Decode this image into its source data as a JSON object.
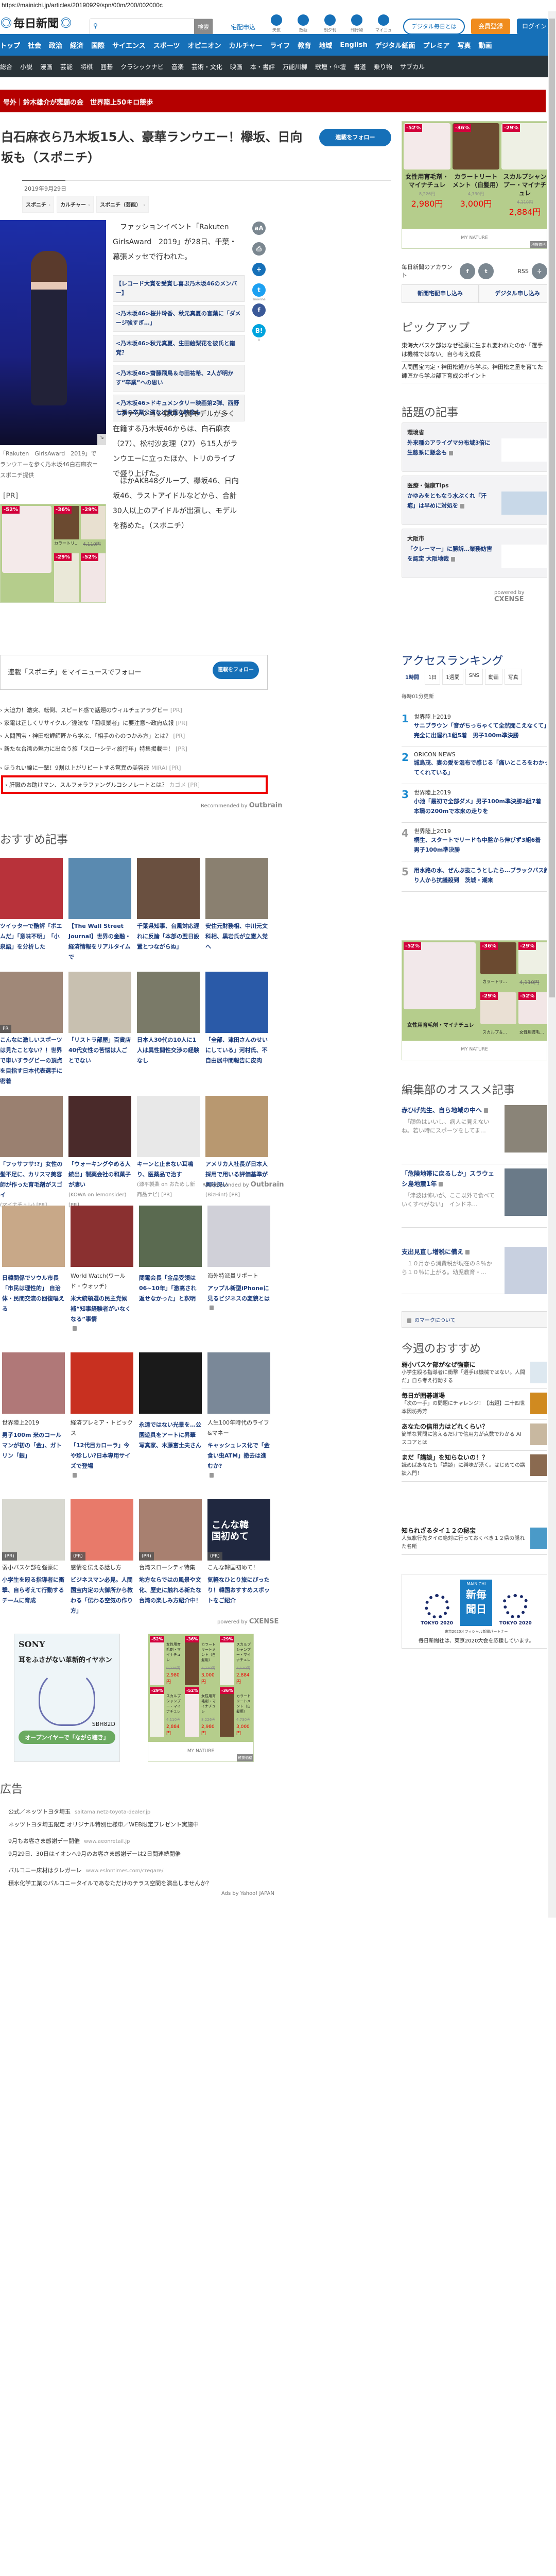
{
  "url": "https://mainichi.jp/articles/20190929/spn/00m/200/002000c",
  "header": {
    "logo": "毎日新聞",
    "search_placeholder": "",
    "search_button": "検索",
    "takuhai": "宅配申込",
    "icons": [
      {
        "label": "天気",
        "icon": "weather-icon"
      },
      {
        "label": "数独",
        "icon": "sudoku-icon"
      },
      {
        "label": "朝夕刊",
        "icon": "newspaper-icon"
      },
      {
        "label": "刊行物",
        "icon": "book-icon"
      },
      {
        "label": "マイニュース",
        "icon": "mynews-icon"
      }
    ],
    "digital": "デジタル毎日とは",
    "register": "会員登録",
    "login": "ログイン"
  },
  "nav": [
    "トップ",
    "社会",
    "政治",
    "経済",
    "国際",
    "サイエンス",
    "スポーツ",
    "オピニオン",
    "カルチャー",
    "ライフ",
    "教育",
    "地域",
    "English",
    "デジタル紙面",
    "プレミア",
    "写真",
    "動画"
  ],
  "subnav": [
    "総合",
    "小説",
    "漫画",
    "芸能",
    "将棋",
    "囲碁",
    "クラシックナビ",
    "音楽",
    "芸術・文化",
    "映画",
    "本・書評",
    "万能川柳",
    "歌壇・俳壇",
    "書道",
    "乗り物",
    "サブカル"
  ],
  "extra": "号外｜鈴木雄介が悲願の金　世界陸上50キロ競歩",
  "article": {
    "title": "白石麻衣ら乃木坂15人、豪華ランウエー！欅坂、日向坂も（スポニチ）",
    "follow": "連載をフォロー",
    "date": "2019年9月29日",
    "tags": [
      "スポニチ",
      "カルチャー",
      "スポニチ（芸能）"
    ],
    "caption": "「Rakuten　GirlsAward　2019」でランウエーを歩く乃木坂46白石麻衣＝スポニチ提供",
    "p1": "　ファッションイベント「Rakuten GirlsAward　2019」が28日、千葉・幕張メッセで行われた。",
    "related": [
      "【レコード大賞を受賞し喜ぶ乃木坂46のメンバー】",
      "<乃木坂46>桜井玲香、秋元真夏の言葉に「ダメージ強すぎ…」",
      "<乃木坂46>秋元真夏、生田絵梨花を彼氏と錯覚？",
      "<乃木坂46>齋藤飛鳥＆与田祐希、2人が明かす“卒業”への思い",
      "<乃木坂46>ドキュメンタリー映画第2弾、西野七瀬の卒業公演など貴重な映像も"
    ],
    "p2": "　ファッション誌の専属モデルが多く在籍する乃木坂46からは、白石麻衣（27）、松村沙友理（27）ら15人がランウエーに立ったほか、トリのライブで盛り上げた。",
    "p3": "　ほかAKB48グループ、欅坂46、日向坂46、ラストアイドルなどから、合計30人以上のアイドルが出演し、モデルを務めた。（スポニチ）",
    "share_twitter_label": "Timeline",
    "share_hatena_count": "0"
  },
  "pr_label": "[PR]",
  "ad_products": [
    {
      "disc": "-52%",
      "name": "女性用育毛剤・マイナチュレ",
      "old": "8,226円",
      "price": "2,980円"
    },
    {
      "disc": "-36%",
      "name": "カラートリートメント（白髪用）",
      "old": "4,730円",
      "price": "3,000円"
    },
    {
      "disc": "-29%",
      "name": "スカルプシャンプー・マイナチュレ",
      "old": "4,110円",
      "price": "2,884円"
    }
  ],
  "ad_brand": "MY NATURE",
  "ad_tax": "税抜価格",
  "ad_small": {
    "label1": "カラートリ...",
    "price": "4,110円",
    "label2": "スカルプ＆...",
    "label3": "女性用育毛...",
    "main": "女性用育毛剤・マイナチュレ",
    "d4": "-29%",
    "d5": "-52%"
  },
  "followbox": {
    "text": "連載「スポニチ」をマイニュースでフォロー",
    "button": "連載をフォロー"
  },
  "pr_links": [
    {
      "t": "大迫力！激突、転倒、スピード感で話題のウィルチェアラグビー",
      "s": "",
      "p": "[PR]"
    },
    {
      "t": "家電は正しくリサイクル／違法な「回収業者」に要注意～政府広報",
      "s": "",
      "p": "[PR]"
    },
    {
      "t": "人間国宝・神田松鯉師匠から学ぶ、「相手の心のつかみ方」とは？",
      "s": "",
      "p": "[PR]"
    },
    {
      "t": "新たな台湾の魅力に出会う旅「スローシティ旅行年」特集掲載中！",
      "s": "",
      "p": "[PR]"
    },
    {
      "t": "ほうれい線に一撃！9割以上がリピートする驚異の美容液",
      "s": "MIRAI",
      "p": "[PR]"
    }
  ],
  "pr_highlight": {
    "t": "肝臓のお助けマン、スルフォラファングルコシノレートとは？",
    "s": "カゴメ",
    "p": "[PR]"
  },
  "recommended_by": "Recommended by",
  "outbrain": "Outbrain",
  "osusume_title": "おすすめ記事",
  "grid1": [
    {
      "t": "ツイッターで酷評「ポエムだ」「意味不明」　「小泉語」を分析した",
      "c": "#b8323a"
    },
    {
      "t": "【The Wall Street Journal】世界の金融・経済情報をリアルタイムで",
      "c": "#5a8ab0"
    },
    {
      "t": "千葉県知事、台風対応遅れに反論「本部の翌日設置とつながらぬ」",
      "c": "#6a5040"
    },
    {
      "t": "安住元財務相、中川元文科相、黒岩氏が立憲入党へ",
      "c": "#8a8070"
    },
    {
      "t": "こんなに激しいスポーツは見たことない？！世界で車いすラグビーの頂点を目指す日本代表選手に密着",
      "c": "#a08878",
      "pr": "PR"
    },
    {
      "t": "「リストラ部屋」百貨店40代女性の苦悩は人ごとでない",
      "c": "#c8c0b0"
    },
    {
      "t": "日本人30代の10人に1人は異性間性交渉の経験なし",
      "c": "#7a7a68"
    },
    {
      "t": "「全部、津田さんのせいにしている」河村氏、不自由展中間報告に皮肉",
      "c": "#2a5aa8"
    },
    {
      "t": "「フッサフサ!?」女性の髪不足に、カリスマ美容師が作った育毛剤がスゴイ",
      "s": "(マイナチュレ) [PR]",
      "c": "#9a8070"
    },
    {
      "t": "「ウォーキングやめる人続出」製薬会社の和菓子が凄い",
      "s": "(KOWA on lemonsider) [PR]",
      "c": "#4a2a2a"
    },
    {
      "t": "キーンと止まない耳鳴り、医薬品で治す",
      "s": "(源平製薬 on おためし新商品ナビ) [PR]",
      "c": "#e8e8e8"
    },
    {
      "t": "アメリカ人社長が日本人採用で用いる評価基準が興味深い",
      "s": "(BizHint) [PR]",
      "c": "#b89870"
    }
  ],
  "grid2": [
    {
      "t": "日韓関係でソウル市長「市民は理性的」 自治体・民間交流の回復唱える",
      "c": "#c8a888"
    },
    {
      "cat": "World Watch(ワールド・ウォッチ)",
      "t": "米大統領選の民主党候補“知事経験者がいなくなる”事情",
      "lock": true,
      "c": "#8a3030"
    },
    {
      "t": "関電会長「金品受領は06~10年」「激高され返せなかった」と釈明",
      "c": "#5a6a50"
    },
    {
      "cat": "海外特派員リポート",
      "t": "アップル新型iPhoneに見るビジネスの変貌とは",
      "lock": true,
      "c": "#d0d0d8"
    },
    {
      "cat": "世界陸上2019",
      "t": "男子100m 米のコールマンが初の「金」、ガトリン「銀」",
      "c": "#b07878"
    },
    {
      "cat": "経済プレミア・トピックス",
      "t": "「12代目カローラ」今や珍しい?日本専用サイズで登場",
      "lock": true,
      "c": "#c83020"
    },
    {
      "t": "永遠ではない光景を…公園遊具をアートに昇華 写真家、木藤富士夫さん",
      "c": "#1a1a1a"
    },
    {
      "cat": "人生100年時代のライフ&マネー",
      "t": "キャッシュレス化で「金食い虫ATM」撤去は進むか?",
      "lock": true,
      "c": "#7a8898"
    },
    {
      "t": "弱小バスケ部を強豪に",
      "s": "小学生を殴る指導者に衝撃、自ら考えて行動するチームに育成",
      "pr": "(PR)",
      "c": "#d8d8d0"
    },
    {
      "t": "感情を伝える話し方",
      "s": "ビジネスマン必見。人間国宝内定の大御所から教わる「伝わる空気の作り方」",
      "pr": "(PR)",
      "c": "#e87a6a"
    },
    {
      "t": "台湾スローシティ特集",
      "s": "地方ならではの風景や文化、歴史に触れる新たな台湾の楽しみ方紹介中！",
      "pr": "(PR)",
      "c": "#a88070"
    },
    {
      "t": "こんな韓国初めて！",
      "s": "気軽なひとり旅にぴったり！韓国おすすめスポットをご紹介",
      "pr": "(PR)",
      "img": "こんな韓国初めて",
      "c": "#202840"
    }
  ],
  "powered_by": "powered by",
  "cxense": "CXENSE",
  "sony": {
    "brand": "SONY",
    "copy": "耳をふさがない革新的イヤホン",
    "model": "SBH82D",
    "cta": "オープンイヤーで「ながら聴き」"
  },
  "ads_title": "広告",
  "ad_links": [
    {
      "t": "公式／ネッツトヨタ埼玉",
      "d": "saitama.netz-toyota-dealer.jp",
      "s": "ネッツトヨタ埼玉限定 オリジナル特別仕様車／WEB限定プレゼント実施中"
    },
    {
      "t": "9月もお客さま感謝デー開催",
      "d": "www.aeonretail.jp",
      "s": "9月29日、30日はイオンへ9月のお客さま感謝デーは2日間連続開催"
    },
    {
      "t": "バルコニー床材はクレガーレ",
      "d": "www.eslontimes.com/cregare/",
      "s": "積水化学工業のバルコニータイルであなただけのテラス空間を演出しませんか？"
    }
  ],
  "ads_by": "Ads by Yahoo! JAPAN",
  "sidebar": {
    "account": "毎日新聞のアカウント",
    "rss": "RSS",
    "btn_paper": "新聞宅配申し込み",
    "btn_digital": "デジタル申し込み",
    "pickup_title": "ピックアップ",
    "pickup": [
      "東海大バスケ部はなぜ強豪に生まれ変われたのか「選手は機械ではない」自ら考え成長",
      "人間国宝内定・神田松鯉から学ぶ。神田松之丞を育てた師匠から学ぶ部下育成のポイント"
    ],
    "topics_title": "話題の記事",
    "topics": [
      {
        "c": "環境省",
        "t": "外来種のアライグマ分布域3倍に 生態系に懸念も"
      },
      {
        "c": "医療・健康Tips",
        "t": "かゆみをともなう水ぶくれ「汗疱」は早めに対処を"
      },
      {
        "c": "大阪市",
        "t": "「クレーマー」に勝訴…業務妨害を認定 大阪地裁"
      }
    ],
    "ranking_title": "アクセスランキング",
    "ranking_tabs": [
      "1時間",
      "1日",
      "1週間",
      "SNS",
      "動画",
      "写真"
    ],
    "ranking_update": "毎時01分更新",
    "ranking": [
      {
        "n": "1",
        "c": "世界陸上2019",
        "t": "サニブラウン「音がちっちゃくて全然聞こえなくて」完全に出遅れ1組5着　男子100m準決勝"
      },
      {
        "n": "2",
        "c": "ORICON NEWS",
        "t": "城島茂、妻の愛を湿布で感じる「痛いところをわかってくれている」"
      },
      {
        "n": "3",
        "c": "世界陸上2019",
        "t": "小池「最初で全部ダメ」男子100m準決勝2組7着　本職の200mで本来の走りを"
      },
      {
        "n": "4",
        "c": "世界陸上2019",
        "t": "桐生、スタートでリードも中盤から伸びず3組6着　男子100m準決勝"
      },
      {
        "n": "5",
        "c": "",
        "t": "用水路の水、ぜんぶ抜こうとしたら…ブラックバス釣り人から抗議殺到　茨城・潮来"
      }
    ],
    "editor_title": "編集部のオススメ記事",
    "editor": [
      {
        "t": "赤ひげ先生、自ら地域の中へ",
        "s": "　「顔色はいいし、病人に見えないね。若い時にスポーツをしてま…"
      },
      {
        "t": "「危険地帯に戻るしか」スラウェシ島地震1年",
        "s": "　「津波は怖いが、ここ以外で食べていくすべがない」　インドネ…"
      },
      {
        "t": "支出見直し増税に備え",
        "s": "　１０月から消費税が現在の８％から１０％に上がる。幼児教育・…"
      }
    ],
    "mark": "のマークについて",
    "week_title": "今週のおすすめ",
    "week": [
      {
        "t": "弱小バスケ部がなぜ強豪に",
        "s": "小学生殴る指導者に衝撃「選手は機械ではない。人間だ」自ら考え行動する"
      },
      {
        "t": "毎日が囲碁道場",
        "s": "「次の一手」の問題にチャレンジ！【出題】二十四世本因坊秀芳"
      },
      {
        "t": "あなたの信用力はどれくらい？",
        "s": "簡単な質問に答えるだけで信用力が点数でわかる AIスコアとは"
      },
      {
        "t": "まだ「講談」を知らないの！？",
        "s": "読めばあなたも「講談」に興味が湧く。はじめての講談入門！"
      },
      {
        "t": "知られざるタイ１２の秘宝",
        "s": "人気旅行先タイの絶対に行っておくべき１２県の隠れた名所"
      }
    ],
    "tokyo": {
      "left": "TOKYO 2020",
      "right": "TOKYO 2020",
      "badge": "新毎聞日",
      "mainichi": "MAINICHI",
      "partner": "東京2020オフィシャル新聞パートナー",
      "support": "毎日新聞社は、東京2020大会を応援しています。"
    }
  },
  "colors": {
    "brand": "#1670b8",
    "extra": "#b50000",
    "subnav": "#2a3338",
    "register": "#f08c1e"
  }
}
